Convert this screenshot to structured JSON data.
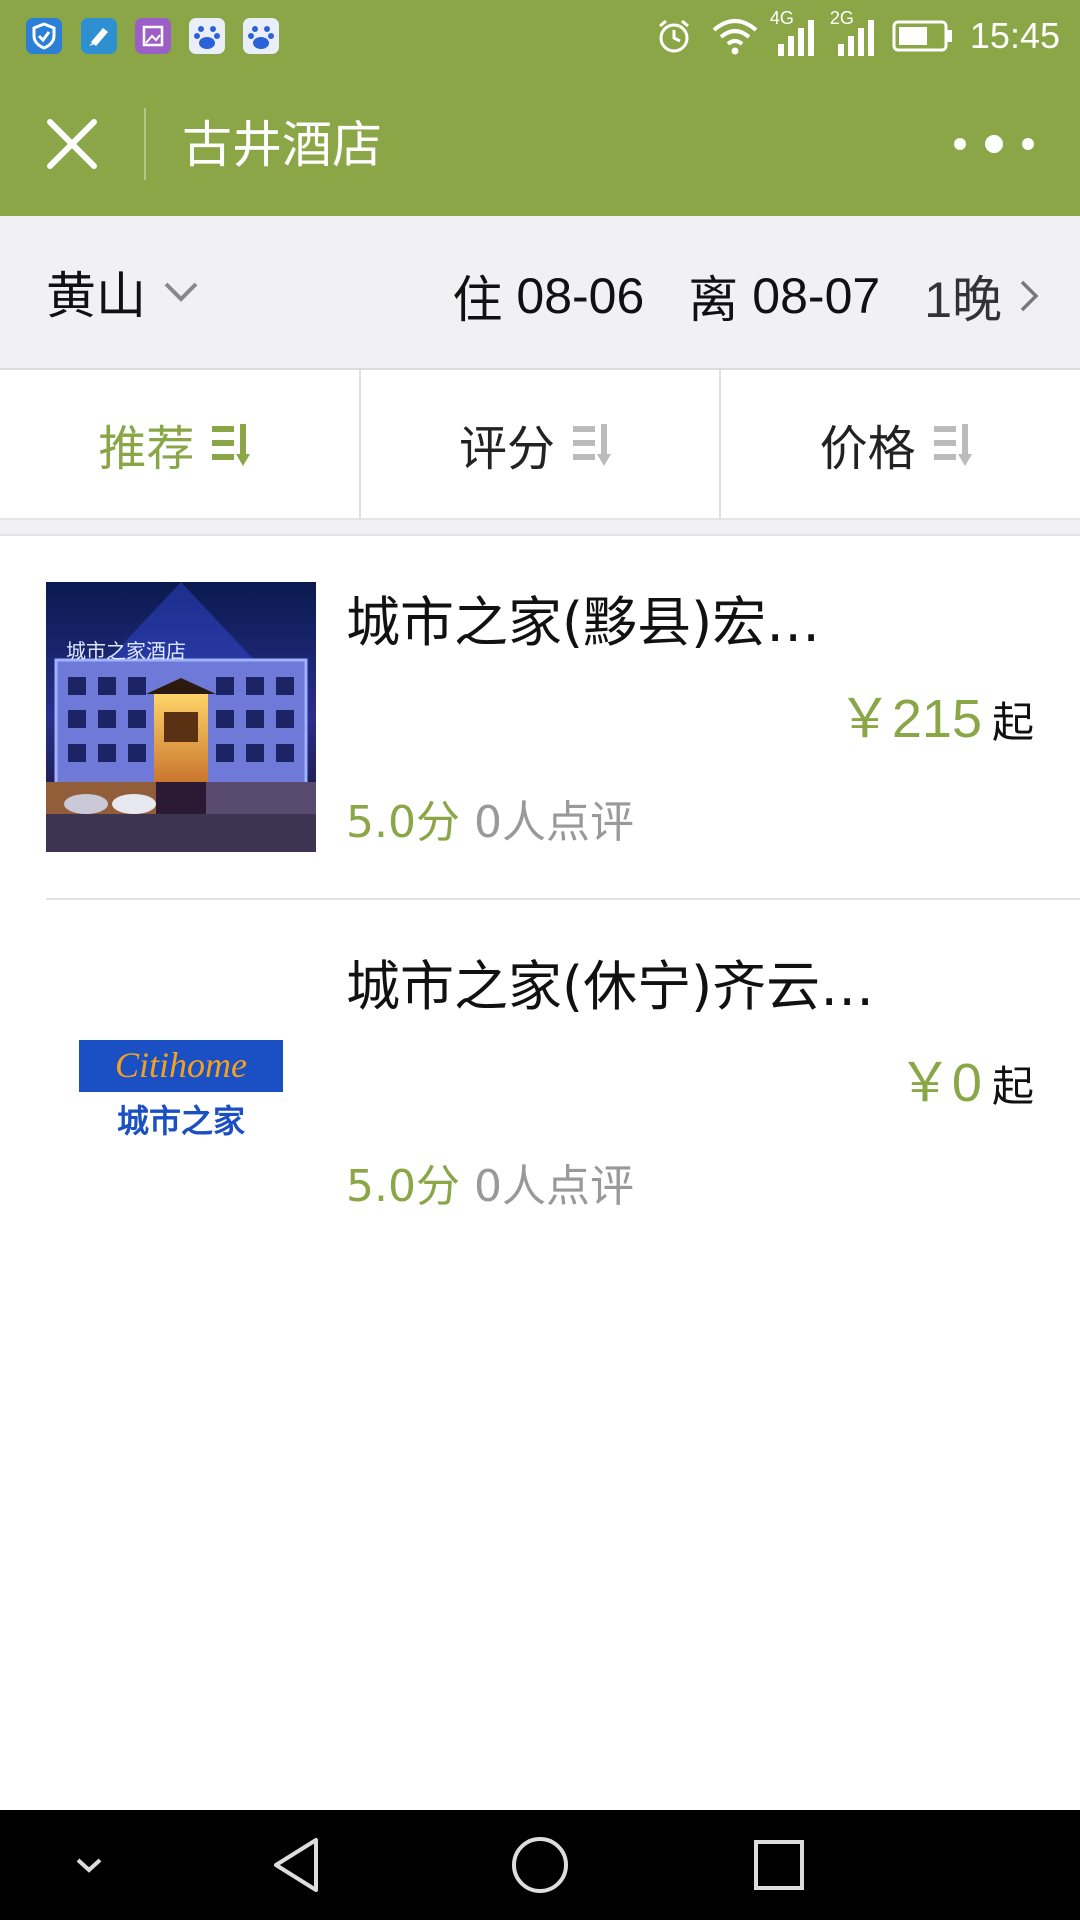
{
  "status_bar": {
    "time": "15:45",
    "network_1": "4G",
    "network_2": "2G",
    "icons": [
      "shield-app-icon",
      "brush-app-icon",
      "gallery-app-icon",
      "baidu-app-icon",
      "baidu-app-icon",
      "alarm-icon",
      "wifi-icon",
      "signal-icon",
      "signal-icon",
      "battery-icon"
    ]
  },
  "header": {
    "title": "古井酒店",
    "close_icon": "close-icon",
    "more_icon": "more-icon"
  },
  "filter": {
    "city": "黄山",
    "checkin_label": "住",
    "checkin_date": "08-06",
    "checkout_label": "离",
    "checkout_date": "08-07",
    "nights": "1晚"
  },
  "sort_tabs": [
    {
      "label": "推荐",
      "active": true
    },
    {
      "label": "评分",
      "active": false
    },
    {
      "label": "价格",
      "active": false
    }
  ],
  "hotels": [
    {
      "name": "城市之家(黟县)宏…",
      "price": "￥215",
      "price_suffix": "起",
      "rating": "5.0分",
      "reviews": "0人点评",
      "thumb_sign": "城市之家酒店"
    },
    {
      "name": "城市之家(休宁)齐云…",
      "price": "￥0",
      "price_suffix": "起",
      "rating": "5.0分",
      "reviews": "0人点评",
      "logo_text_en": "Citihome",
      "logo_text_cn": "城市之家"
    }
  ],
  "colors": {
    "accent": "#8aa647",
    "logo_blue": "#1b4fc4",
    "logo_orange": "#f2a21d"
  },
  "nav_bar": {
    "icons": [
      "collapse-icon",
      "back-icon",
      "home-icon",
      "recents-icon"
    ]
  }
}
